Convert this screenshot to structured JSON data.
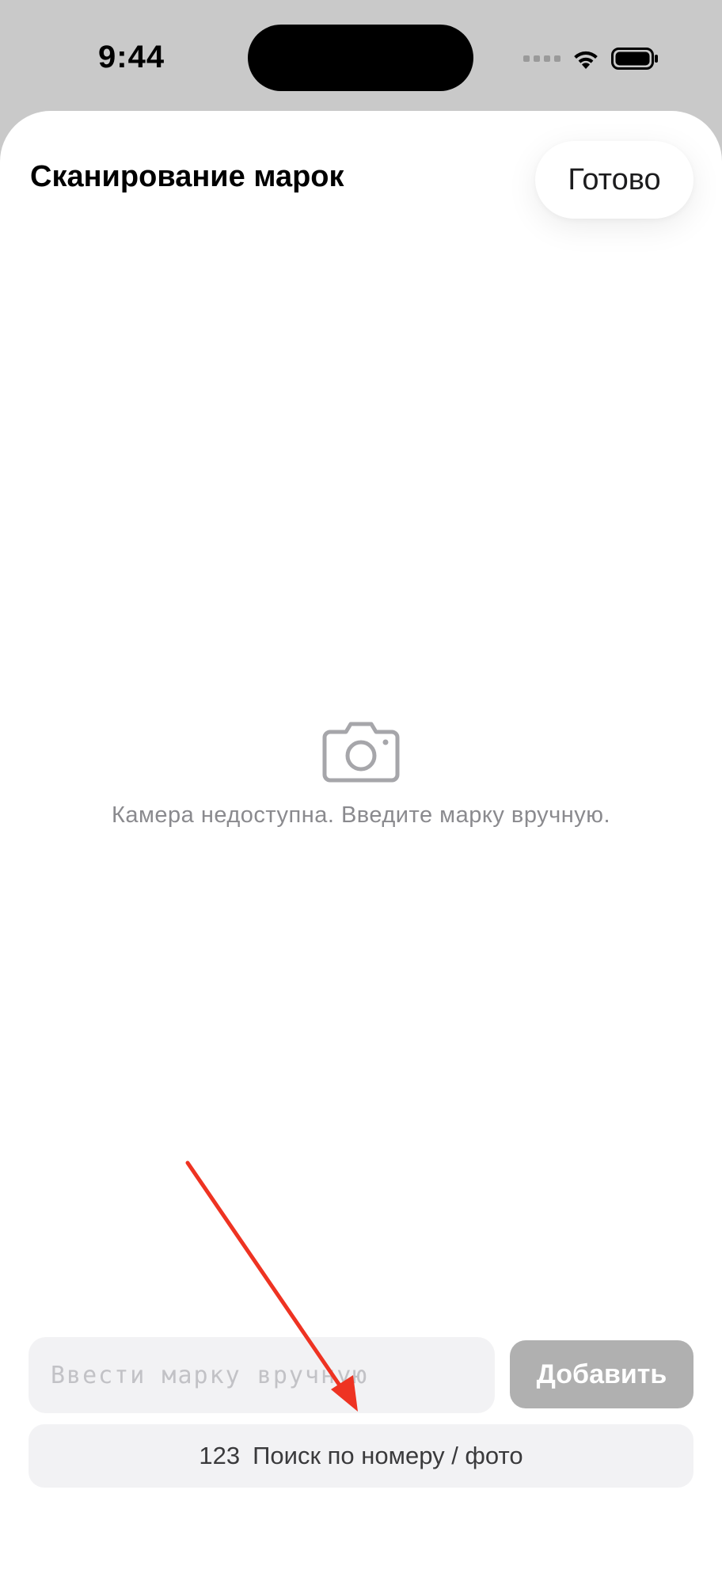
{
  "status_bar": {
    "time": "9:44"
  },
  "sheet": {
    "title": "Сканирование марок",
    "done_label": "Готово"
  },
  "camera": {
    "icon": "camera-icon",
    "message": "Камера недоступна. Введите марку вручную."
  },
  "manual_entry": {
    "placeholder": "Ввести марку вручную",
    "value": "",
    "add_label": "Добавить"
  },
  "search": {
    "icon_text": "123",
    "label": "Поиск по номеру / фото"
  },
  "colors": {
    "annotation_arrow": "#ee3322",
    "add_button_disabled": "#b0b0b0",
    "field_background": "#f2f2f4"
  }
}
